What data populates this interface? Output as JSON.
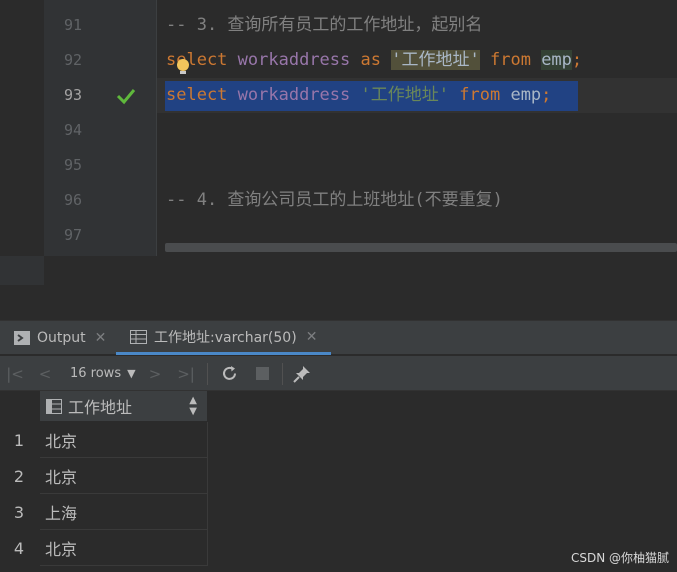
{
  "editor": {
    "line_numbers": [
      "91",
      "92",
      "93",
      "94",
      "95",
      "96",
      "97"
    ],
    "current_line": "93",
    "comment_1": "-- 3. 查询所有员工的工作地址，起别名",
    "line_92": {
      "kw_select": "select",
      "col": "workaddress",
      "kw_as": "as",
      "alias": "'工作地址'",
      "kw_from": "from",
      "table": "emp",
      "end": ";"
    },
    "line_93": {
      "kw_select": "select",
      "col": "workaddress",
      "alias": "'工作地址'",
      "kw_from": "from",
      "table": "emp",
      "end": ";"
    },
    "comment_2": "-- 4. 查询公司员工的上班地址(不要重复)"
  },
  "tabs": [
    {
      "label": "Output",
      "icon": "console-icon",
      "active": false
    },
    {
      "label": "工作地址:varchar(50)",
      "icon": "table-icon",
      "active": true
    }
  ],
  "toolbar": {
    "rows_label": "16 rows",
    "buttons": [
      "first-page-icon",
      "prev-page-icon",
      "next-page-icon",
      "last-page-icon",
      "refresh-icon",
      "stop-icon",
      "pin-icon"
    ]
  },
  "grid": {
    "column": "工作地址",
    "rows": [
      {
        "num": "1",
        "value": "北京"
      },
      {
        "num": "2",
        "value": "北京"
      },
      {
        "num": "3",
        "value": "上海"
      },
      {
        "num": "4",
        "value": "北京"
      }
    ]
  },
  "watermark": "CSDN @你柚猫腻",
  "colors": {
    "keyword": "#cc7832",
    "identifier": "#9876aa",
    "string": "#6a8759",
    "selection": "#214283",
    "check": "#5fb83c",
    "active_tab": "#4a88c7"
  }
}
